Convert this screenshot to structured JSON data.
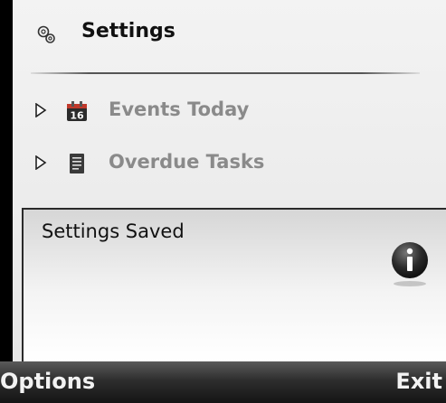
{
  "header": {
    "title": "Settings",
    "icon": "gear-icon"
  },
  "list": {
    "items": [
      {
        "label": "Events Today",
        "icon": "calendar-icon",
        "calendar_day": "16"
      },
      {
        "label": "Overdue Tasks",
        "icon": "notepad-icon"
      }
    ]
  },
  "note": {
    "message": "Settings Saved",
    "icon": "info-icon"
  },
  "softkeys": {
    "left": "Options",
    "right": "Exit"
  },
  "colors": {
    "label_grey": "#8a8a8a",
    "softkey_bar": "#2e2e2e"
  }
}
